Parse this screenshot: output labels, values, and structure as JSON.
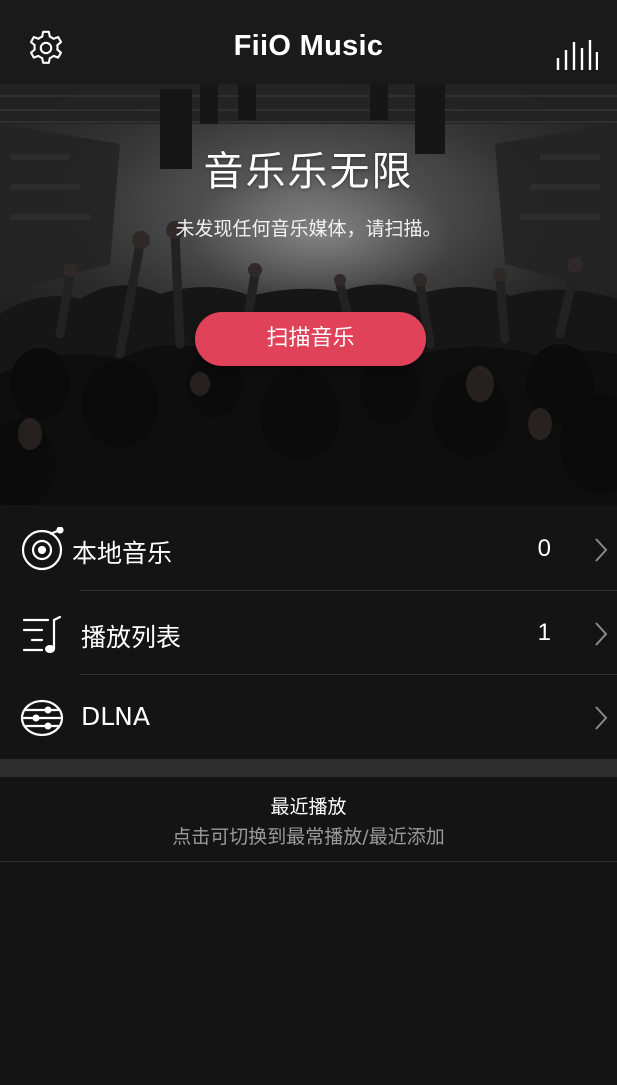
{
  "header": {
    "title": "FiiO Music",
    "settings_icon": "gear-icon",
    "equalizer_icon": "equalizer-bars-icon"
  },
  "hero": {
    "headline": "音乐乐无限",
    "subtitle": "未发现任何音乐媒体，请扫描。",
    "scan_button_label": "扫描音乐"
  },
  "library": {
    "items": [
      {
        "label": "本地音乐",
        "count": "0",
        "icon": "vinyl-disc-icon"
      },
      {
        "label": "播放列表",
        "count": "1",
        "icon": "playlist-icon"
      },
      {
        "label": "DLNA",
        "count": "",
        "icon": "dlna-network-icon"
      }
    ]
  },
  "recent": {
    "title": "最近播放",
    "subtitle": "点击可切换到最常播放/最近添加"
  },
  "colors": {
    "accent": "#e04259",
    "background": "#141414",
    "header_background": "#1a1a1a"
  }
}
